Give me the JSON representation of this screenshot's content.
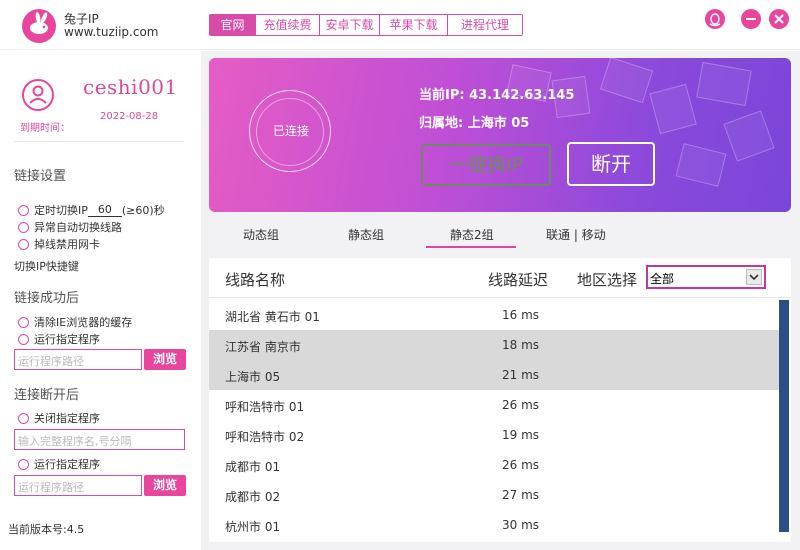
{
  "app": {
    "name": "兔子IP",
    "url": "www.tuziip.com"
  },
  "nav": {
    "items": [
      "官网",
      "充值续费",
      "安卓下载",
      "苹果下载",
      "进程代理"
    ]
  },
  "user": {
    "username": "ceshi001",
    "expire_label": "到期时间：",
    "expire_date": "2022-08-28"
  },
  "settings": {
    "link_title": "链接设置",
    "timed_switch_prefix": "定时切换IP",
    "timed_switch_value": "60",
    "timed_switch_suffix": "(≥60)秒",
    "auto_switch": "异常自动切换线路",
    "disable_nic": "掉线禁用网卡",
    "shortcut": "切换IP快捷键",
    "success_title": "链接成功后",
    "clear_cache": "清除IE浏览器的缓存",
    "run_program": "运行指定程序",
    "program_path_placeholder": "运行程序路径",
    "browse": "浏览",
    "disconnect_title": "连接断开后",
    "close_program": "关闭指定程序",
    "close_program_placeholder": "输入完整程序名,号分隔",
    "run_program_2": "运行指定程序",
    "program_path_placeholder_2": "运行程序路径",
    "browse_2": "浏览",
    "version": "当前版本号:4.5"
  },
  "status": {
    "connected": "已连接",
    "current_ip": "当前IP: 43.142.63.145",
    "location": "归属地: 上海市 05",
    "switch_button": "一键换IP",
    "disconnect_button": "断开"
  },
  "tabs": [
    "动态组",
    "静态组",
    "静态2组",
    "联通 | 移动"
  ],
  "active_tab": "静态2组",
  "list": {
    "col_name": "线路名称",
    "col_latency": "线路延迟",
    "region_label": "地区选择",
    "region_value": "全部",
    "rows": [
      {
        "name": "湖北省 黄石市 01",
        "latency": "16 ms"
      },
      {
        "name": "江苏省 南京市",
        "latency": "18 ms"
      },
      {
        "name": "上海市 05",
        "latency": "21 ms"
      },
      {
        "name": "呼和浩特市 01",
        "latency": "26 ms"
      },
      {
        "name": "呼和浩特市 02",
        "latency": "19 ms"
      },
      {
        "name": "成都市 01",
        "latency": "26 ms"
      },
      {
        "name": "成都市 02",
        "latency": "27 ms"
      },
      {
        "name": "杭州市 01",
        "latency": "30 ms"
      }
    ]
  },
  "colors": {
    "accent": "#e8469d",
    "banner_start": "#e65cc4",
    "banner_end": "#7a46d9",
    "scroll_thumb": "#2d4e86"
  }
}
